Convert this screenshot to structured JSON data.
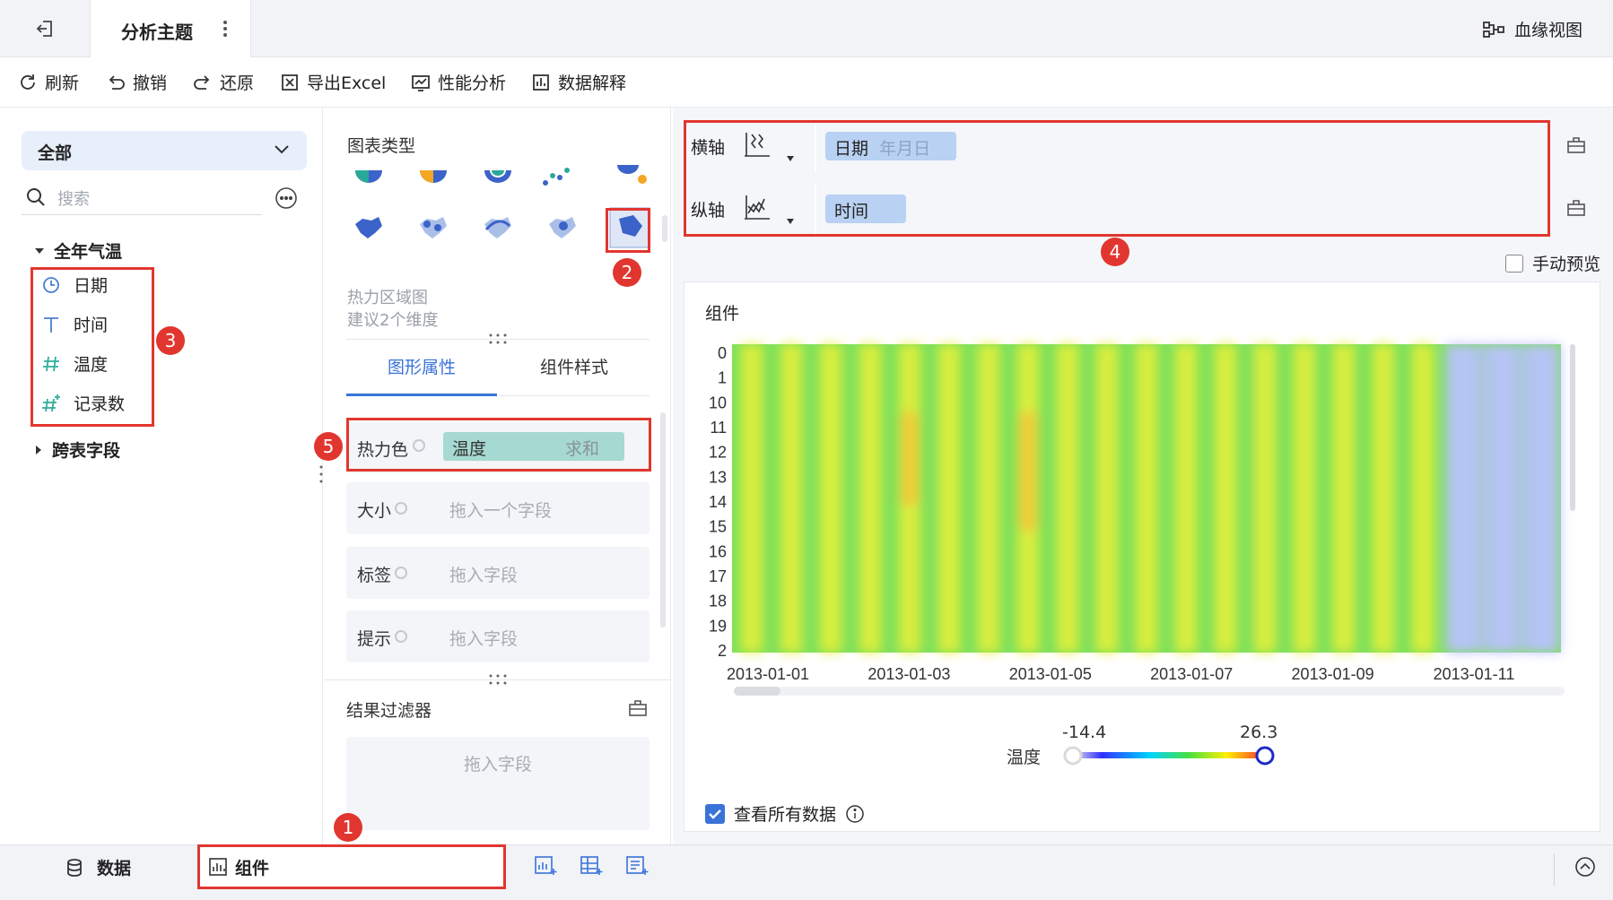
{
  "topbar": {
    "title": "分析主题",
    "lineage_label": "血缘视图"
  },
  "toolbar": {
    "refresh": "刷新",
    "undo": "撤销",
    "redo": "还原",
    "export": "导出Excel",
    "perf": "性能分析",
    "explain": "数据解释"
  },
  "fields": {
    "scope_select": "全部",
    "search_placeholder": "搜索",
    "group_name": "全年气温",
    "items": [
      {
        "label": "日期",
        "icon": "clock-icon"
      },
      {
        "label": "时间",
        "icon": "text-type-icon"
      },
      {
        "label": "温度",
        "icon": "hash-icon"
      },
      {
        "label": "记录数",
        "icon": "hash-plus-icon"
      }
    ],
    "cross_table": "跨表字段"
  },
  "chart_types": {
    "title": "图表类型",
    "selected_name": "热力区域图",
    "selected_hint": "建议2个维度"
  },
  "tabs": {
    "graph_props": "图形属性",
    "component_style": "组件样式"
  },
  "marks": {
    "heat_color": {
      "label": "热力色",
      "field": "温度",
      "agg": "求和"
    },
    "size": {
      "label": "大小",
      "placeholder": "拖入一个字段"
    },
    "tag": {
      "label": "标签",
      "placeholder": "拖入字段"
    },
    "tooltip": {
      "label": "提示",
      "placeholder": "拖入字段"
    }
  },
  "filter": {
    "title": "结果过滤器",
    "placeholder": "拖入字段"
  },
  "axes": {
    "x_label": "横轴",
    "x_field": "日期",
    "x_sub": "年月日",
    "y_label": "纵轴",
    "y_field": "时间"
  },
  "manual_preview": "手动预览",
  "chart": {
    "component_title": "组件",
    "legend_field": "温度",
    "legend_min": "-14.4",
    "legend_max": "26.3",
    "view_all": "查看所有数据"
  },
  "chart_data": {
    "type": "heatmap",
    "x_ticks": [
      "2013-01-01",
      "2013-01-03",
      "2013-01-05",
      "2013-01-07",
      "2013-01-09",
      "2013-01-11"
    ],
    "y_ticks": [
      "0",
      "1",
      "10",
      "11",
      "12",
      "13",
      "14",
      "15",
      "16",
      "17",
      "18",
      "19",
      "2"
    ],
    "legend": {
      "name": "温度",
      "min": -14.4,
      "max": 26.3
    }
  },
  "bottom": {
    "data_tab": "数据",
    "component_tab": "组件"
  },
  "badges": [
    "1",
    "2",
    "3",
    "4",
    "5"
  ]
}
